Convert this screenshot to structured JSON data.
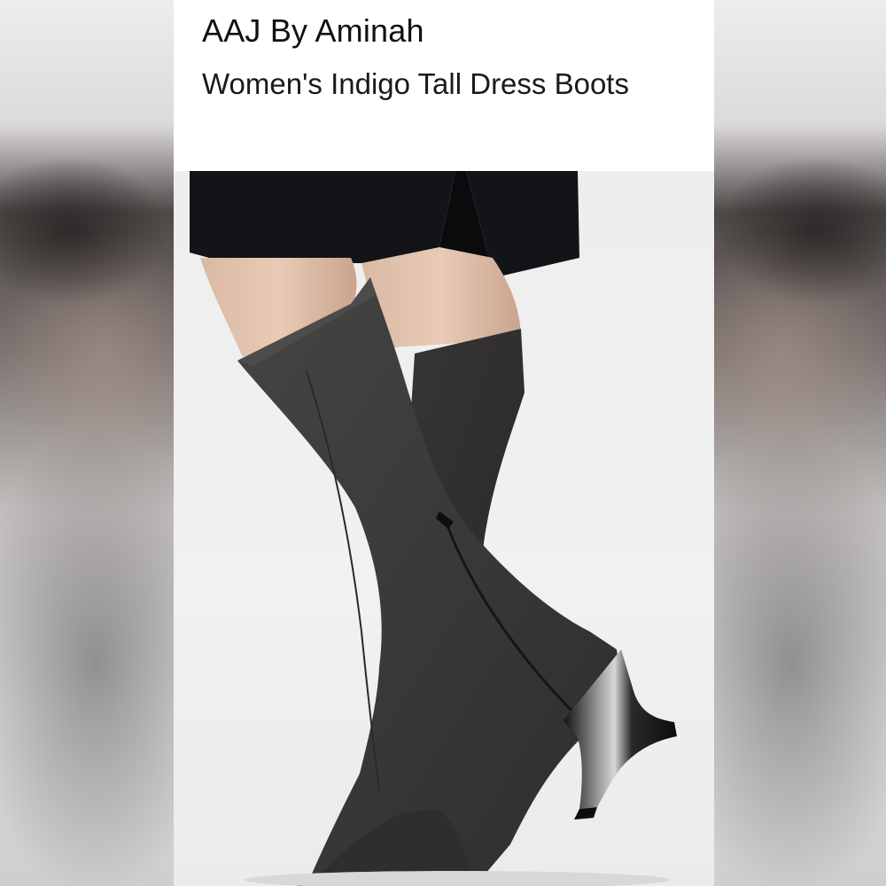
{
  "listing": {
    "brand": "AAJ By Aminah",
    "title": "Women's Indigo Tall Dress Boots"
  },
  "photo": {
    "subject": "boots-product-photo"
  },
  "colors": {
    "card_background": "#ffffff",
    "text": "#111111",
    "skirt": "#121417",
    "suede": "#3b3b3a",
    "heel": "#1c1c1c"
  }
}
